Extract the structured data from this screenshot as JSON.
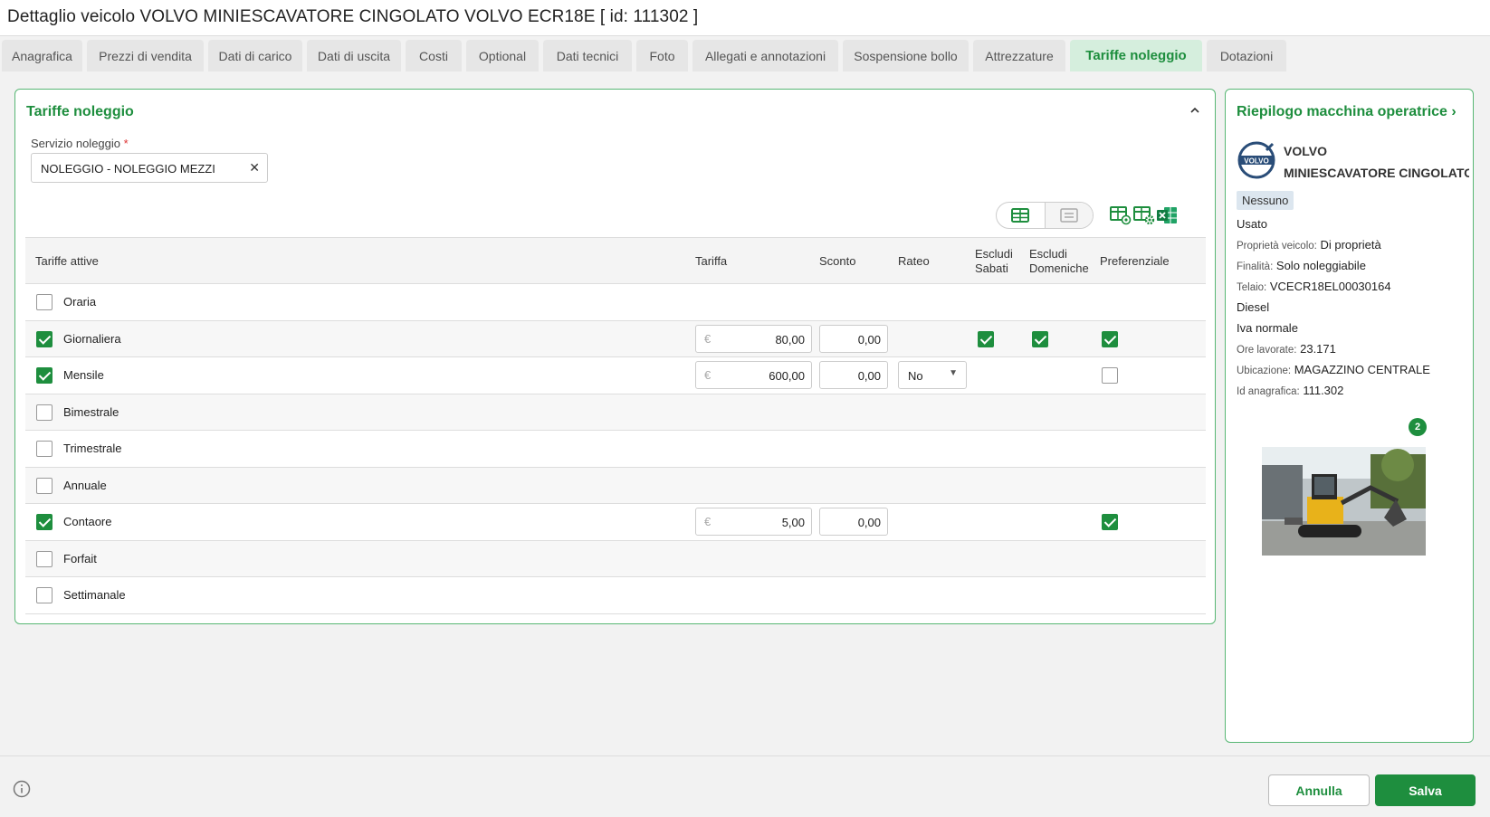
{
  "window": {
    "title": "Dettaglio veicolo VOLVO MINIESCAVATORE CINGOLATO VOLVO ECR18E [ id: 111302 ]"
  },
  "tabs": [
    {
      "label": "Anagrafica"
    },
    {
      "label": "Prezzi di vendita"
    },
    {
      "label": "Dati di carico"
    },
    {
      "label": "Dati di uscita"
    },
    {
      "label": "Costi"
    },
    {
      "label": "Optional"
    },
    {
      "label": "Dati tecnici"
    },
    {
      "label": "Foto"
    },
    {
      "label": "Allegati e annotazioni"
    },
    {
      "label": "Sospensione bollo"
    },
    {
      "label": "Attrezzature"
    },
    {
      "label": "Tariffe noleggio"
    },
    {
      "label": "Dotazioni"
    }
  ],
  "active_tab": "Tariffe noleggio",
  "main": {
    "title": "Tariffe noleggio",
    "service_label": "Servizio noleggio",
    "required_mark": "*",
    "service_value": "NOLEGGIO - NOLEGGIO MEZZI",
    "columns": {
      "tariffe_attive": "Tariffe attive",
      "tariffa": "Tariffa",
      "sconto": "Sconto",
      "rateo": "Rateo",
      "escludi_sabati_1": "Escludi",
      "escludi_sabati_2": "Sabati",
      "escludi_domeniche_1": "Escludi",
      "escludi_domeniche_2": "Domeniche",
      "preferenziale": "Preferenziale"
    },
    "currency_symbol": "€",
    "rows": [
      {
        "label": "Oraria",
        "active": false
      },
      {
        "label": "Giornaliera",
        "active": true,
        "tariffa": "80,00",
        "sconto": "0,00",
        "escludi_sabati": true,
        "escludi_domeniche": true,
        "preferenziale": true
      },
      {
        "label": "Mensile",
        "active": true,
        "tariffa": "600,00",
        "sconto": "0,00",
        "rateo": "No",
        "preferenziale": false
      },
      {
        "label": "Bimestrale",
        "active": false
      },
      {
        "label": "Trimestrale",
        "active": false
      },
      {
        "label": "Annuale",
        "active": false
      },
      {
        "label": "Contaore",
        "active": true,
        "tariffa": "5,00",
        "sconto": "0,00",
        "preferenziale": true
      },
      {
        "label": "Forfait",
        "active": false
      },
      {
        "label": "Settimanale",
        "active": false
      }
    ]
  },
  "side": {
    "title": "Riepilogo macchina operatrice",
    "brand": "VOLVO",
    "model": "MINIESCAVATORE CINGOLATO",
    "logo_text": "VOLVO",
    "badge": "Nessuno",
    "condition": "Usato",
    "ownership_key": "Proprietà veicolo:",
    "ownership_val": "Di proprietà",
    "purpose_key": "Finalità:",
    "purpose_val": "Solo noleggiabile",
    "chassis_key": "Telaio:",
    "chassis_val": "VCECR18EL00030164",
    "fuel": "Diesel",
    "vat": "Iva normale",
    "hours_key": "Ore lavorate:",
    "hours_val": "23.171",
    "location_key": "Ubicazione:",
    "location_val": "MAGAZZINO CENTRALE",
    "id_key": "Id anagrafica:",
    "id_val": "111.302",
    "photo_count": "2"
  },
  "footer": {
    "cancel_label": "Annulla",
    "save_label": "Salva"
  },
  "colors": {
    "accent": "#1e8e3e",
    "tab_active_bg": "#d5eedd",
    "border_green": "#58b774"
  }
}
